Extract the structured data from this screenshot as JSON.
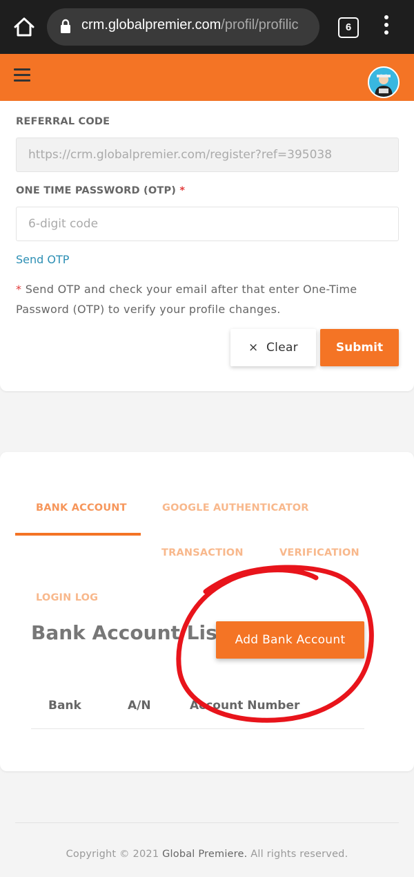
{
  "browser": {
    "url_domain": "crm.globalpremier.com",
    "url_path": "/profil/profilic",
    "tab_count": "6"
  },
  "form": {
    "referral_label": "REFERRAL CODE",
    "referral_value": "https://crm.globalpremier.com/register?ref=395038",
    "otp_label": "ONE TIME PASSWORD (OTP)",
    "required_mark": "*",
    "otp_placeholder": "6-digit code",
    "send_otp_link": "Send OTP",
    "note_mark": "*",
    "note_text": "Send OTP and check your email after that enter One-Time Password (OTP) to verify your profile changes.",
    "clear_icon": "×",
    "clear_label": "Clear",
    "submit_label": "Submit"
  },
  "tabs": [
    {
      "label": "BANK ACCOUNT",
      "active": true
    },
    {
      "label": "GOOGLE AUTHENTICATOR",
      "active": false
    },
    {
      "label": "TRANSACTION",
      "active": false
    },
    {
      "label": "VERIFICATION",
      "active": false
    },
    {
      "label": "LOGIN LOG",
      "active": false
    }
  ],
  "bank": {
    "title": "Bank Account List",
    "add_button": "Add Bank Account",
    "columns": [
      "Bank",
      "A/N",
      "Account Number"
    ]
  },
  "footer": {
    "prefix": "Copyright © 2021",
    "brand": "Global Premiere.",
    "suffix": "All rights reserved."
  },
  "colors": {
    "accent": "#f47425",
    "link": "#2d8fb4",
    "annotation": "#e8141b"
  }
}
